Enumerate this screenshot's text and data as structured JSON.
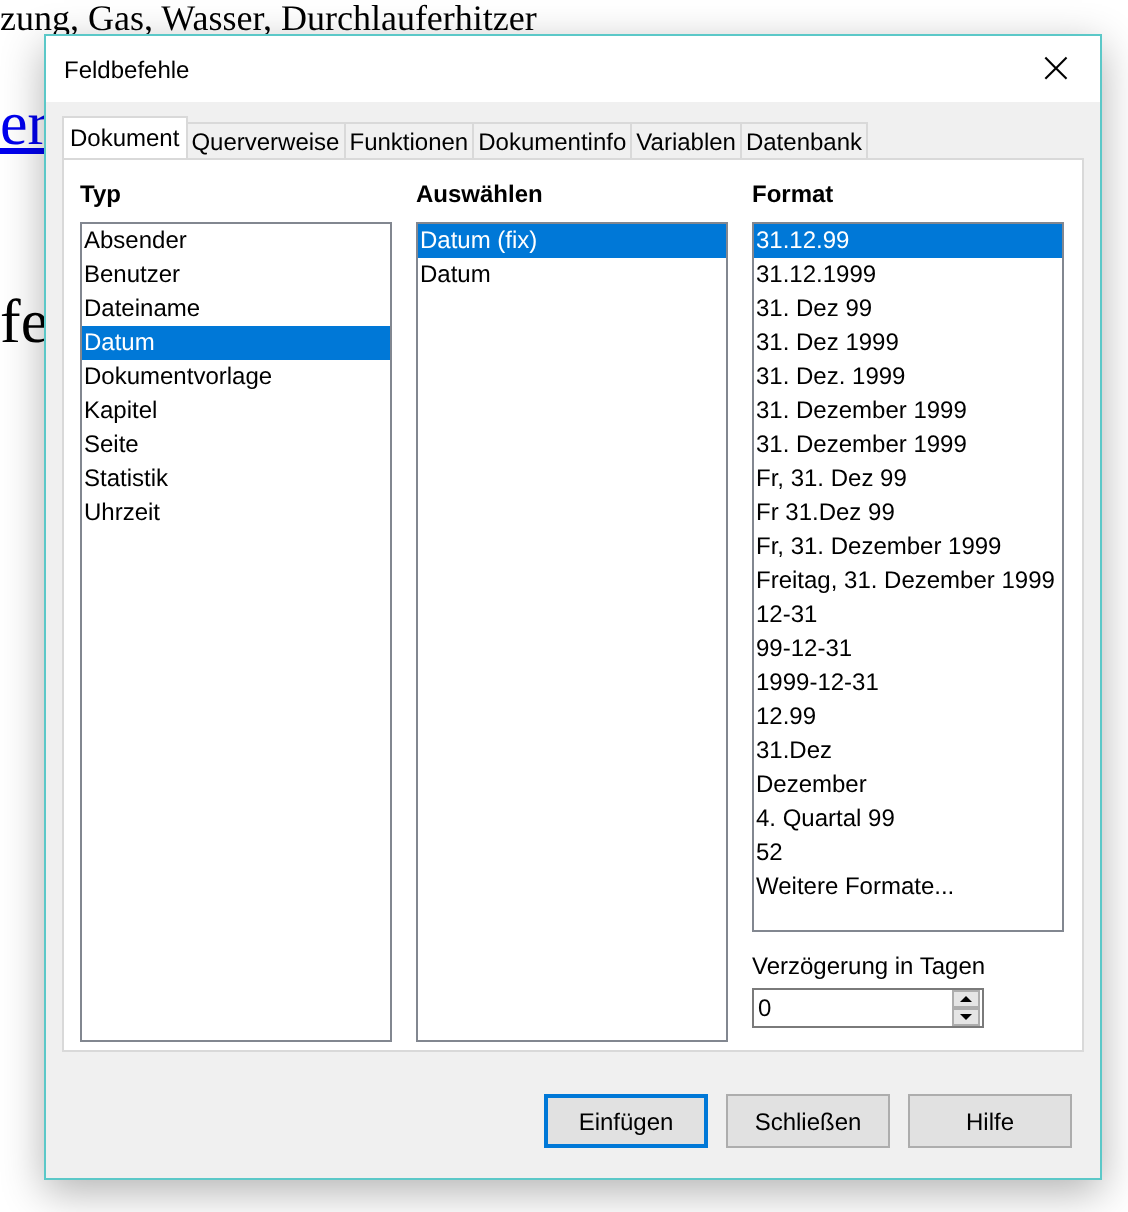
{
  "document": {
    "lines": [
      {
        "kind": "text",
        "text": "zung, Gas, Wasser, Durchlauferhitzer"
      },
      {
        "kind": "link",
        "text": "er"
      },
      {
        "kind": "text",
        "text": "fe"
      }
    ]
  },
  "window": {
    "title": "Feldbefehle",
    "close": "×"
  },
  "tabs": [
    {
      "label": "Dokument",
      "selected": true
    },
    {
      "label": "Querverweise",
      "selected": false
    },
    {
      "label": "Funktionen",
      "selected": false
    },
    {
      "label": "Dokumentinfo",
      "selected": false
    },
    {
      "label": "Variablen",
      "selected": false
    },
    {
      "label": "Datenbank",
      "selected": false
    }
  ],
  "type_list": {
    "label": "Typ",
    "items": [
      {
        "label": "Absender",
        "selected": false
      },
      {
        "label": "Benutzer",
        "selected": false
      },
      {
        "label": "Dateiname",
        "selected": false
      },
      {
        "label": "Datum",
        "selected": true
      },
      {
        "label": "Dokumentvorlage",
        "selected": false
      },
      {
        "label": "Kapitel",
        "selected": false
      },
      {
        "label": "Seite",
        "selected": false
      },
      {
        "label": "Statistik",
        "selected": false
      },
      {
        "label": "Uhrzeit",
        "selected": false
      }
    ]
  },
  "select_list": {
    "label": "Auswählen",
    "items": [
      {
        "label": "Datum (fix)",
        "selected": true
      },
      {
        "label": "Datum",
        "selected": false
      }
    ]
  },
  "format_list": {
    "label": "Format",
    "items": [
      {
        "label": "31.12.99",
        "selected": true
      },
      {
        "label": "31.12.1999",
        "selected": false
      },
      {
        "label": "31. Dez 99",
        "selected": false
      },
      {
        "label": "31. Dez 1999",
        "selected": false
      },
      {
        "label": "31. Dez. 1999",
        "selected": false
      },
      {
        "label": "31. Dezember 1999",
        "selected": false
      },
      {
        "label": "31. Dezember 1999",
        "selected": false
      },
      {
        "label": "Fr, 31. Dez 99",
        "selected": false
      },
      {
        "label": "Fr 31.Dez 99",
        "selected": false
      },
      {
        "label": "Fr, 31. Dezember 1999",
        "selected": false
      },
      {
        "label": "Freitag, 31. Dezember 1999",
        "selected": false
      },
      {
        "label": "12-31",
        "selected": false
      },
      {
        "label": "99-12-31",
        "selected": false
      },
      {
        "label": "1999-12-31",
        "selected": false
      },
      {
        "label": "12.99",
        "selected": false
      },
      {
        "label": "31.Dez",
        "selected": false
      },
      {
        "label": "Dezember",
        "selected": false
      },
      {
        "label": "4. Quartal 99",
        "selected": false
      },
      {
        "label": "52",
        "selected": false
      },
      {
        "label": "Weitere Formate...",
        "selected": false
      }
    ]
  },
  "offset": {
    "label": "Verzögerung in Tagen",
    "value": "0"
  },
  "buttons": [
    {
      "label": "Einfügen",
      "default": true
    },
    {
      "label": "Schließen",
      "default": false
    },
    {
      "label": "Hilfe",
      "default": false
    }
  ]
}
